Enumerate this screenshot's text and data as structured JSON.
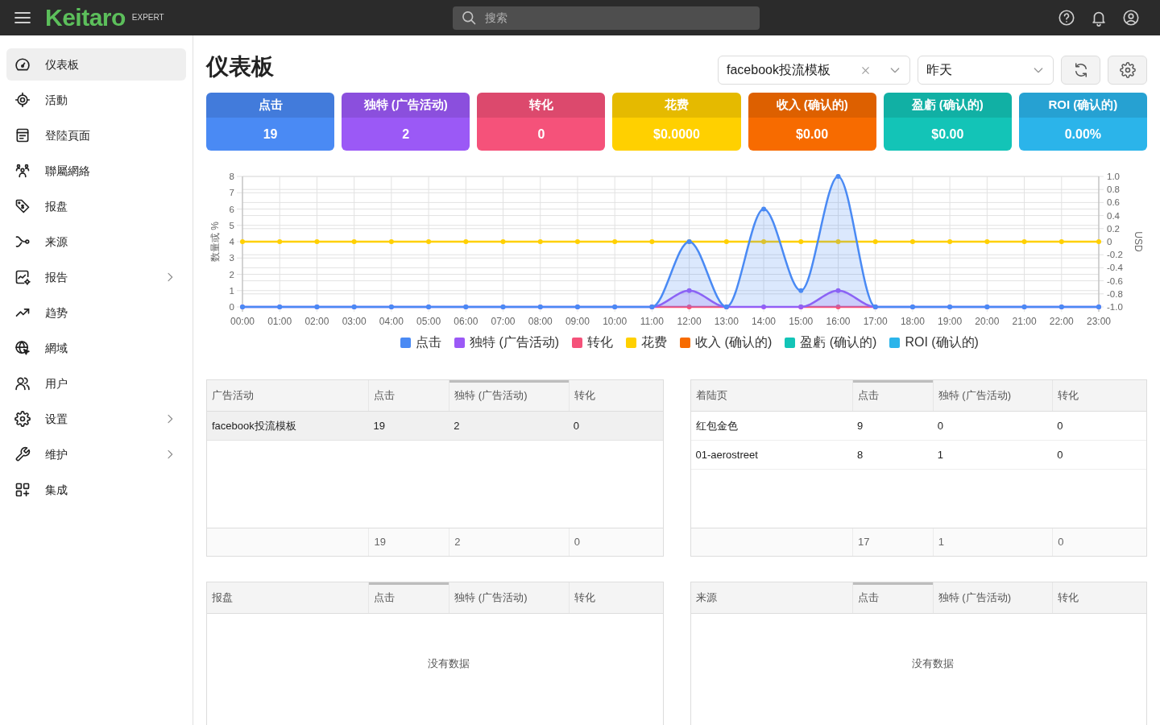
{
  "topbar": {
    "logo": "Keitaro",
    "edition": "EXPERT",
    "search": {
      "placeholder": "搜索"
    }
  },
  "sidebar": {
    "items": [
      {
        "label": "仪表板",
        "selected": true,
        "submenu": false
      },
      {
        "label": "活動",
        "selected": false,
        "submenu": false
      },
      {
        "label": "登陸頁面",
        "selected": false,
        "submenu": false
      },
      {
        "label": "聯屬網絡",
        "selected": false,
        "submenu": false
      },
      {
        "label": "报盘",
        "selected": false,
        "submenu": false
      },
      {
        "label": "来源",
        "selected": false,
        "submenu": false
      },
      {
        "label": "报告",
        "selected": false,
        "submenu": true
      },
      {
        "label": "趋势",
        "selected": false,
        "submenu": false
      },
      {
        "label": "網域",
        "selected": false,
        "submenu": false
      },
      {
        "label": "用户",
        "selected": false,
        "submenu": false
      },
      {
        "label": "设置",
        "selected": false,
        "submenu": true
      },
      {
        "label": "维护",
        "selected": false,
        "submenu": true
      },
      {
        "label": "集成",
        "selected": false,
        "submenu": false
      }
    ]
  },
  "header": {
    "title": "仪表板",
    "campaign_filter": {
      "value": "facebook投流模板"
    },
    "period_filter": {
      "value": "昨天"
    }
  },
  "stats": [
    {
      "label": "点击",
      "value": "19",
      "color": "#4a8af4"
    },
    {
      "label": "独特 (广告活动)",
      "value": "2",
      "color": "#9b59f6"
    },
    {
      "label": "转化",
      "value": "0",
      "color": "#f5527a"
    },
    {
      "label": "花费",
      "value": "$0.0000",
      "color": "#ffd000"
    },
    {
      "label": "收入 (确认的)",
      "value": "$0.00",
      "color": "#f76b00"
    },
    {
      "label": "盈虧 (确认的)",
      "value": "$0.00",
      "color": "#13c4b7"
    },
    {
      "label": "ROI (确认的)",
      "value": "0.00%",
      "color": "#2bb4ea"
    }
  ],
  "chart": {
    "chart_data": {
      "type": "line",
      "grid": true,
      "legend": true,
      "ylabel": "数量或 %",
      "y2label": "USD",
      "x": [
        "00:00",
        "01:00",
        "02:00",
        "03:00",
        "04:00",
        "05:00",
        "06:00",
        "07:00",
        "08:00",
        "09:00",
        "10:00",
        "11:00",
        "12:00",
        "13:00",
        "14:00",
        "15:00",
        "16:00",
        "17:00",
        "18:00",
        "19:00",
        "20:00",
        "21:00",
        "22:00",
        "23:00"
      ],
      "ylim": [
        0,
        8
      ],
      "yticks": [
        0,
        1,
        2,
        3,
        4,
        5,
        6,
        7,
        8
      ],
      "y2lim": [
        -1,
        1
      ],
      "y2ticks": [
        {
          "value": -1,
          "label": "-1.0"
        },
        {
          "value": -0.8,
          "label": "-0.8"
        },
        {
          "value": -0.6,
          "label": "-0.6"
        },
        {
          "value": -0.4,
          "label": "-0.4"
        },
        {
          "value": -0.2,
          "label": "-0.2"
        },
        {
          "value": 0,
          "label": "0"
        },
        {
          "value": 0.2,
          "label": "0.2"
        },
        {
          "value": 0.4,
          "label": "0.4"
        },
        {
          "value": 0.6,
          "label": "0.6"
        },
        {
          "value": 0.8,
          "label": "0.8"
        },
        {
          "value": 1,
          "label": "1.0"
        }
      ],
      "series": [
        {
          "name": "点击",
          "color": "#4a8af4",
          "type": "area",
          "marker": "circle",
          "values": [
            0,
            0,
            0,
            0,
            0,
            0,
            0,
            0,
            0,
            0,
            0,
            0,
            4,
            0,
            6,
            1,
            8,
            0,
            0,
            0,
            0,
            0,
            0,
            0
          ]
        },
        {
          "name": "独特 (广告活动)",
          "color": "#9b59f6",
          "type": "area",
          "marker": "circle",
          "values": [
            0,
            0,
            0,
            0,
            0,
            0,
            0,
            0,
            0,
            0,
            0,
            0,
            1,
            0,
            0,
            0,
            1,
            0,
            0,
            0,
            0,
            0,
            0,
            0
          ]
        },
        {
          "name": "转化",
          "color": "#f5527a",
          "marker": "circle",
          "values": [
            null,
            null,
            null,
            null,
            null,
            null,
            null,
            null,
            null,
            null,
            null,
            0,
            0,
            0,
            null,
            0,
            0,
            0,
            null,
            null,
            null,
            null,
            null,
            null
          ]
        },
        {
          "name": "花费",
          "color": "#ffd000",
          "axis": "y2",
          "marker": "circle",
          "values": [
            0,
            0,
            0,
            0,
            0,
            0,
            0,
            0,
            0,
            0,
            0,
            0,
            0,
            0,
            0,
            0,
            0,
            0,
            0,
            0,
            0,
            0,
            0,
            0
          ]
        },
        {
          "name": "收入 (确认的)",
          "color": "#f76b00",
          "axis": "y2",
          "values": [
            null,
            null,
            null,
            null,
            null,
            null,
            null,
            null,
            null,
            null,
            null,
            null,
            null,
            null,
            null,
            null,
            null,
            null,
            null,
            null,
            null,
            null,
            null,
            null
          ]
        },
        {
          "name": "盈虧 (确认的)",
          "color": "#13c4b7",
          "axis": "y2",
          "values": [
            null,
            null,
            null,
            null,
            null,
            null,
            null,
            null,
            null,
            null,
            null,
            null,
            null,
            null,
            null,
            null,
            null,
            null,
            null,
            null,
            null,
            null,
            null,
            null
          ]
        },
        {
          "name": "ROI (确认的)",
          "color": "#2bb4ea",
          "values": [
            null,
            null,
            null,
            null,
            null,
            null,
            null,
            null,
            null,
            null,
            null,
            null,
            null,
            null,
            null,
            null,
            null,
            null,
            null,
            null,
            null,
            null,
            null,
            null
          ]
        }
      ]
    }
  },
  "tables": [
    {
      "columns": [
        {
          "label": "广告活动",
          "sorted": false
        },
        {
          "label": "点击",
          "sorted": false
        },
        {
          "label": "独特 (广告活动)",
          "sorted": true
        },
        {
          "label": "转化",
          "sorted": false
        }
      ],
      "rows": [
        {
          "cells": [
            "facebook投流模板",
            "19",
            "2",
            "0"
          ],
          "highlighted": true
        }
      ],
      "totals": [
        "19",
        "2",
        "0"
      ]
    },
    {
      "columns": [
        {
          "label": "着陆页",
          "sorted": false
        },
        {
          "label": "点击",
          "sorted": true
        },
        {
          "label": "独特 (广告活动)",
          "sorted": false
        },
        {
          "label": "转化",
          "sorted": false
        }
      ],
      "rows": [
        {
          "cells": [
            "红包金色",
            "9",
            "0",
            "0"
          ],
          "highlighted": false
        },
        {
          "cells": [
            "01-aerostreet",
            "8",
            "1",
            "0"
          ],
          "highlighted": false
        }
      ],
      "totals": [
        "17",
        "1",
        "0"
      ]
    },
    {
      "columns": [
        {
          "label": "报盘",
          "sorted": false
        },
        {
          "label": "点击",
          "sorted": true
        },
        {
          "label": "独特 (广告活动)",
          "sorted": false
        },
        {
          "label": "转化",
          "sorted": false
        }
      ],
      "empty_message": "没有数据"
    },
    {
      "columns": [
        {
          "label": "来源",
          "sorted": false
        },
        {
          "label": "点击",
          "sorted": true
        },
        {
          "label": "独特 (广告活动)",
          "sorted": false
        },
        {
          "label": "转化",
          "sorted": false
        }
      ],
      "empty_message": "没有数据"
    }
  ]
}
